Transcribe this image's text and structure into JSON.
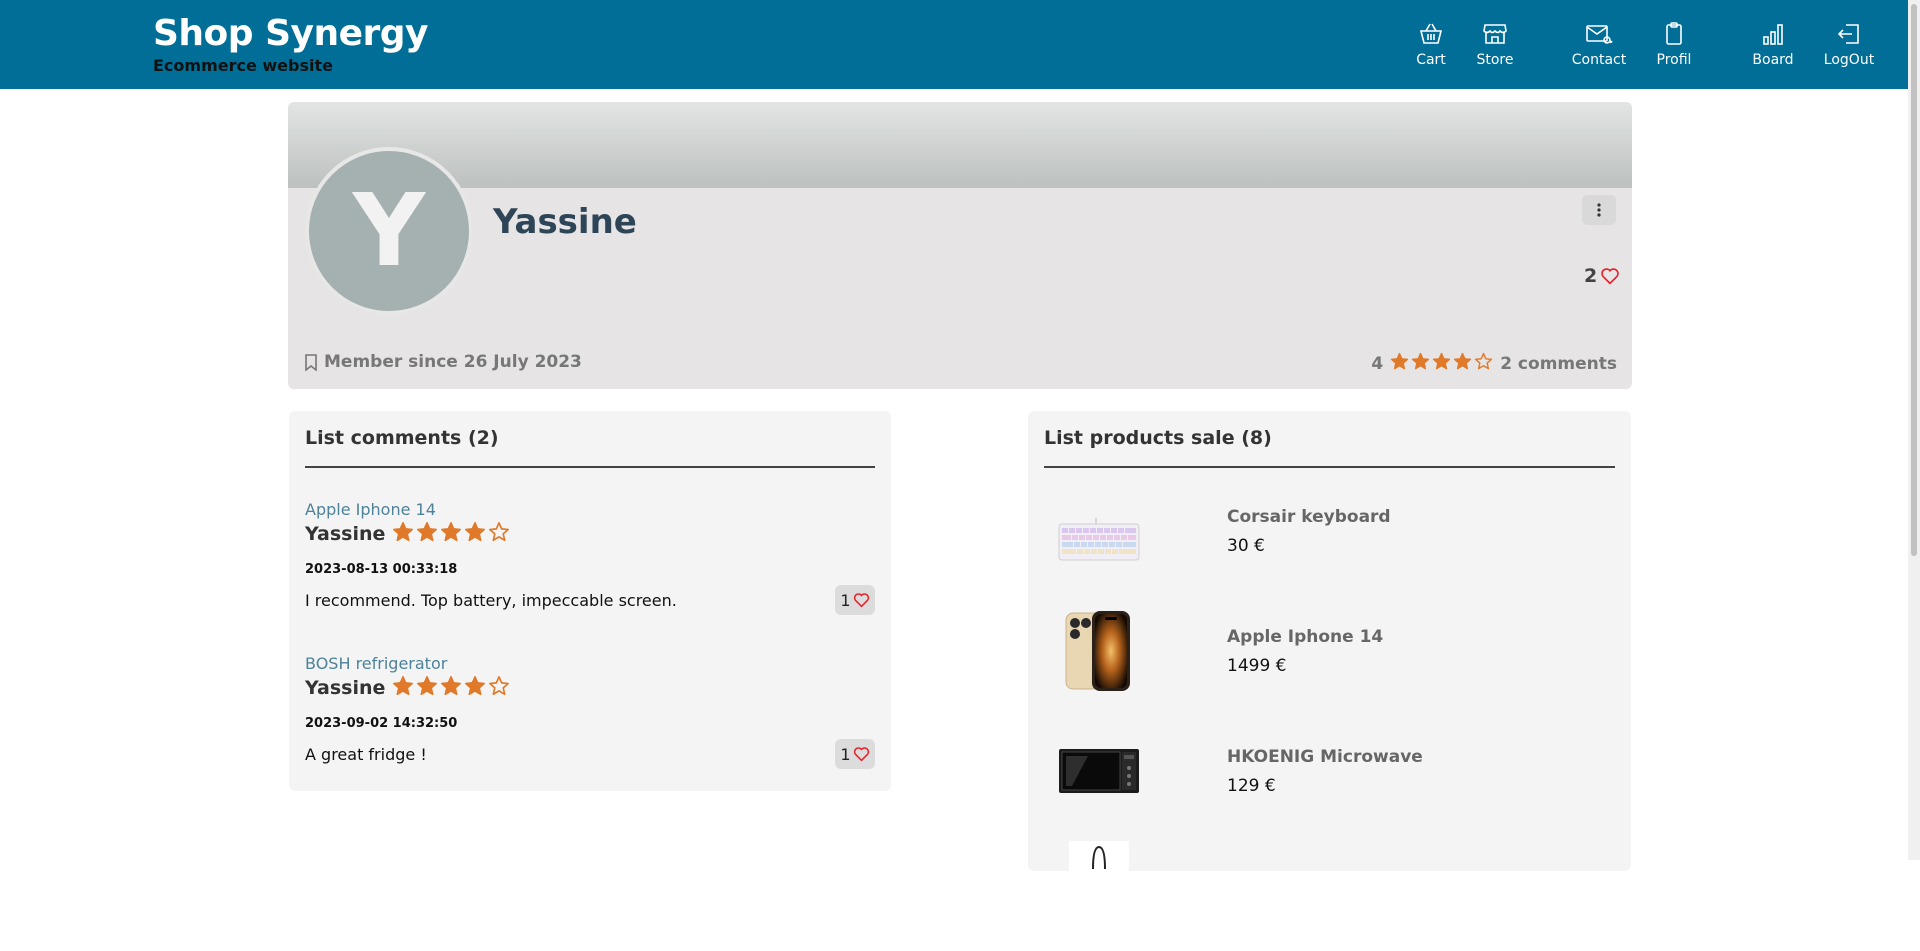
{
  "header": {
    "title": "Shop Synergy",
    "subtitle": "Ecommerce website",
    "nav": [
      {
        "label": "Cart",
        "icon": "basket-icon"
      },
      {
        "label": "Store",
        "icon": "store-icon"
      },
      {
        "label": "Contact",
        "icon": "mail-at-icon"
      },
      {
        "label": "Profil",
        "icon": "clipboard-icon"
      },
      {
        "label": "Board",
        "icon": "bar-chart-icon"
      },
      {
        "label": "LogOut",
        "icon": "logout-icon"
      }
    ]
  },
  "profile": {
    "initial": "Y",
    "name": "Yassine",
    "likes": "2",
    "member_since": "Member since 26 July 2023",
    "rating_value": "4",
    "rating_stars": 4,
    "comments_count": "2 comments"
  },
  "comments_panel": {
    "title": "List comments (2)",
    "items": [
      {
        "product": "Apple Iphone 14",
        "author": "Yassine",
        "stars": 4,
        "date": "2023-08-13 00:33:18",
        "text": "I recommend. Top battery, impeccable screen.",
        "likes": "1"
      },
      {
        "product": "BOSH refrigerator",
        "author": "Yassine",
        "stars": 4,
        "date": "2023-09-02 14:32:50",
        "text": "A great fridge !",
        "likes": "1"
      }
    ]
  },
  "products_panel": {
    "title": "List products sale (8)",
    "items": [
      {
        "name": "Corsair keyboard",
        "price": "30 €",
        "image": "keyboard-image"
      },
      {
        "name": "Apple Iphone 14",
        "price": "1499 €",
        "image": "phone-image"
      },
      {
        "name": "HKOENIG Microwave",
        "price": "129 €",
        "image": "microwave-image"
      },
      {
        "name": "",
        "price": "",
        "image": "bag-image"
      }
    ]
  },
  "colors": {
    "header_bg": "#006e96",
    "star": "#e07a2a",
    "heart": "#e8202a",
    "link": "#4d8299"
  }
}
